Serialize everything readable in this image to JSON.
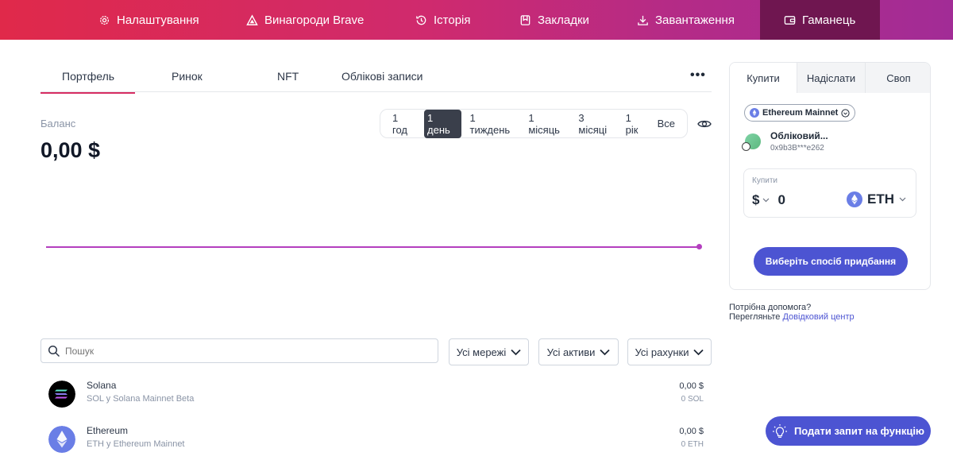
{
  "nav": {
    "items": [
      {
        "label": "Налаштування",
        "icon": "gear-icon"
      },
      {
        "label": "Винагороди Brave",
        "icon": "rewards-triangle-icon"
      },
      {
        "label": "Історія",
        "icon": "history-icon"
      },
      {
        "label": "Закладки",
        "icon": "bookmark-icon"
      },
      {
        "label": "Завантаження",
        "icon": "download-icon"
      },
      {
        "label": "Гаманець",
        "icon": "wallet-icon"
      }
    ],
    "active": "Гаманець",
    "colors": {
      "gradient_start": "#e0294a",
      "gradient_end": "#a22c96",
      "active_bg": "#6f1650"
    }
  },
  "tabs": {
    "items": [
      "Портфель",
      "Ринок",
      "NFT",
      "Облікові записи"
    ],
    "active": "Портфель",
    "more_label": "•••"
  },
  "balance": {
    "label": "Баланс",
    "value": "0,00 $"
  },
  "time_range": {
    "options": [
      "1 год",
      "1 день",
      "1 тиждень",
      "1 місяць",
      "3 місяці",
      "1 рік",
      "Все"
    ],
    "selected": "1 день"
  },
  "chart_color": "#b43fbf",
  "search": {
    "placeholder": "Пошук"
  },
  "filters": [
    "Усі мережі",
    "Усі активи",
    "Усі рахунки"
  ],
  "assets": [
    {
      "name": "Solana",
      "network": "SOL у Solana Mainnet Beta",
      "fiat": "0,00 $",
      "amount": "0 SOL",
      "icon": "solana-icon"
    },
    {
      "name": "Ethereum",
      "network": "ETH у Ethereum Mainnet",
      "fiat": "0,00 $",
      "amount": "0 ETH",
      "icon": "ethereum-icon"
    }
  ],
  "panel": {
    "tabs": [
      "Купити",
      "Надіслати",
      "Своп"
    ],
    "active_tab": "Купити",
    "network": "Ethereum Mainnet",
    "account_name": "Обліковий...",
    "account_address": "0x9b3B***e262",
    "buy_label": "Купити",
    "currency": "$",
    "amount": "0",
    "asset": "ETH",
    "cta": "Виберіть спосіб придбання"
  },
  "help": {
    "line1": "Потрібна допомога?",
    "line2_prefix": "Перегляньте",
    "link": "Довідковий центр"
  },
  "feature_request": "Подати запит на функцію",
  "accent_color": "#4c54d2"
}
